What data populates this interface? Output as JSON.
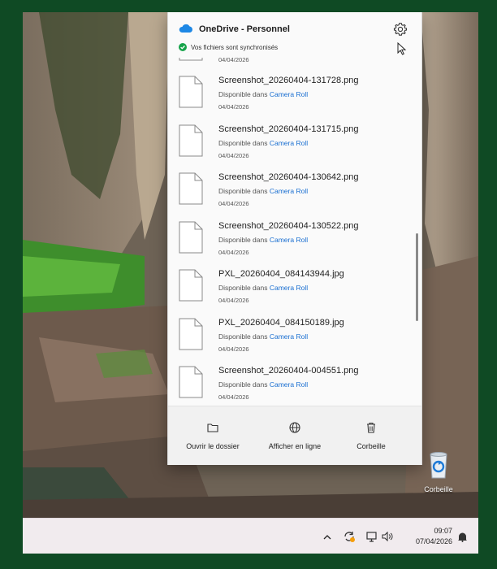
{
  "flyout": {
    "title": "OneDrive - Personnel",
    "status": "Vos fichiers sont synchronisés",
    "partial_date": "04/04/2026",
    "files": [
      {
        "name": "Screenshot_20260404-131728.png",
        "available_prefix": "Disponible dans",
        "location": "Camera Roll",
        "date": "04/04/2026"
      },
      {
        "name": "Screenshot_20260404-131715.png",
        "available_prefix": "Disponible dans",
        "location": "Camera Roll",
        "date": "04/04/2026"
      },
      {
        "name": "Screenshot_20260404-130642.png",
        "available_prefix": "Disponible dans",
        "location": "Camera Roll",
        "date": "04/04/2026"
      },
      {
        "name": "Screenshot_20260404-130522.png",
        "available_prefix": "Disponible dans",
        "location": "Camera Roll",
        "date": "04/04/2026"
      },
      {
        "name": "PXL_20260404_084143944.jpg",
        "available_prefix": "Disponible dans",
        "location": "Camera Roll",
        "date": "04/04/2026"
      },
      {
        "name": "PXL_20260404_084150189.jpg",
        "available_prefix": "Disponible dans",
        "location": "Camera Roll",
        "date": "04/04/2026"
      },
      {
        "name": "Screenshot_20260404-004551.png",
        "available_prefix": "Disponible dans",
        "location": "Camera Roll",
        "date": "04/04/2026"
      }
    ],
    "actions": {
      "open_folder": "Ouvrir le dossier",
      "view_online": "Afficher en ligne",
      "recycle_bin": "Corbeille"
    }
  },
  "desktop": {
    "recycle_bin_label": "Corbeille"
  },
  "taskbar": {
    "time": "09:07",
    "date": "07/04/2026"
  },
  "colors": {
    "frame": "#0f4a24",
    "link": "#1a6fd1",
    "sync_ok": "#16a34a",
    "onedrive": "#1e88e5"
  },
  "icons": [
    "onedrive-cloud-icon",
    "sync-check-icon",
    "gear-icon",
    "mouse-cursor-icon",
    "file-icon",
    "folder-icon",
    "globe-icon",
    "trash-icon",
    "recycle-bin-icon",
    "chevron-up-icon",
    "sync-status-icon",
    "network-icon",
    "volume-icon",
    "notification-icon"
  ]
}
